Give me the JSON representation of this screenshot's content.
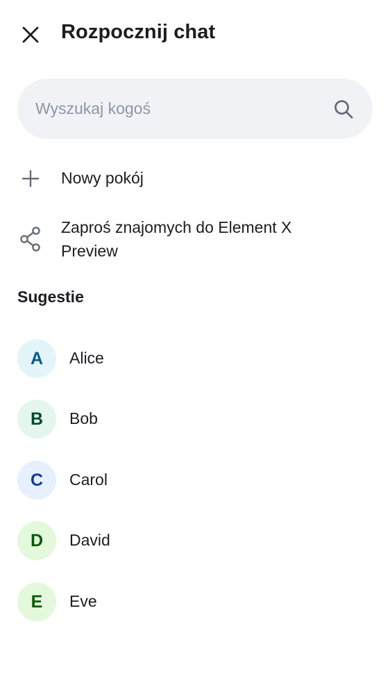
{
  "header": {
    "title": "Rozpocznij chat",
    "close_icon": "close-icon"
  },
  "search": {
    "placeholder": "Wyszukaj kogoś",
    "value": "",
    "icon": "search-icon"
  },
  "actions": [
    {
      "label": "Nowy pokój",
      "icon": "plus-icon"
    },
    {
      "label": "Zaproś znajomych do Element X Preview",
      "icon": "share-icon"
    }
  ],
  "suggestions": {
    "title": "Sugestie",
    "users": [
      {
        "initial": "A",
        "name": "Alice",
        "avatar_bg": "#e3f5f8",
        "avatar_fg": "#005f85"
      },
      {
        "initial": "B",
        "name": "Bob",
        "avatar_bg": "#e3f7ed",
        "avatar_fg": "#004933"
      },
      {
        "initial": "C",
        "name": "Carol",
        "avatar_bg": "#e7f0ff",
        "avatar_fg": "#0a3fa1"
      },
      {
        "initial": "D",
        "name": "David",
        "avatar_bg": "#e4f8dc",
        "avatar_fg": "#005c00"
      },
      {
        "initial": "E",
        "name": "Eve",
        "avatar_bg": "#e4f8dc",
        "avatar_fg": "#005c00"
      }
    ]
  },
  "colors": {
    "text_primary": "#1b1d22",
    "text_placeholder": "#8d97a5",
    "icon_secondary": "#656d77",
    "search_background": "#f0f2f5"
  }
}
